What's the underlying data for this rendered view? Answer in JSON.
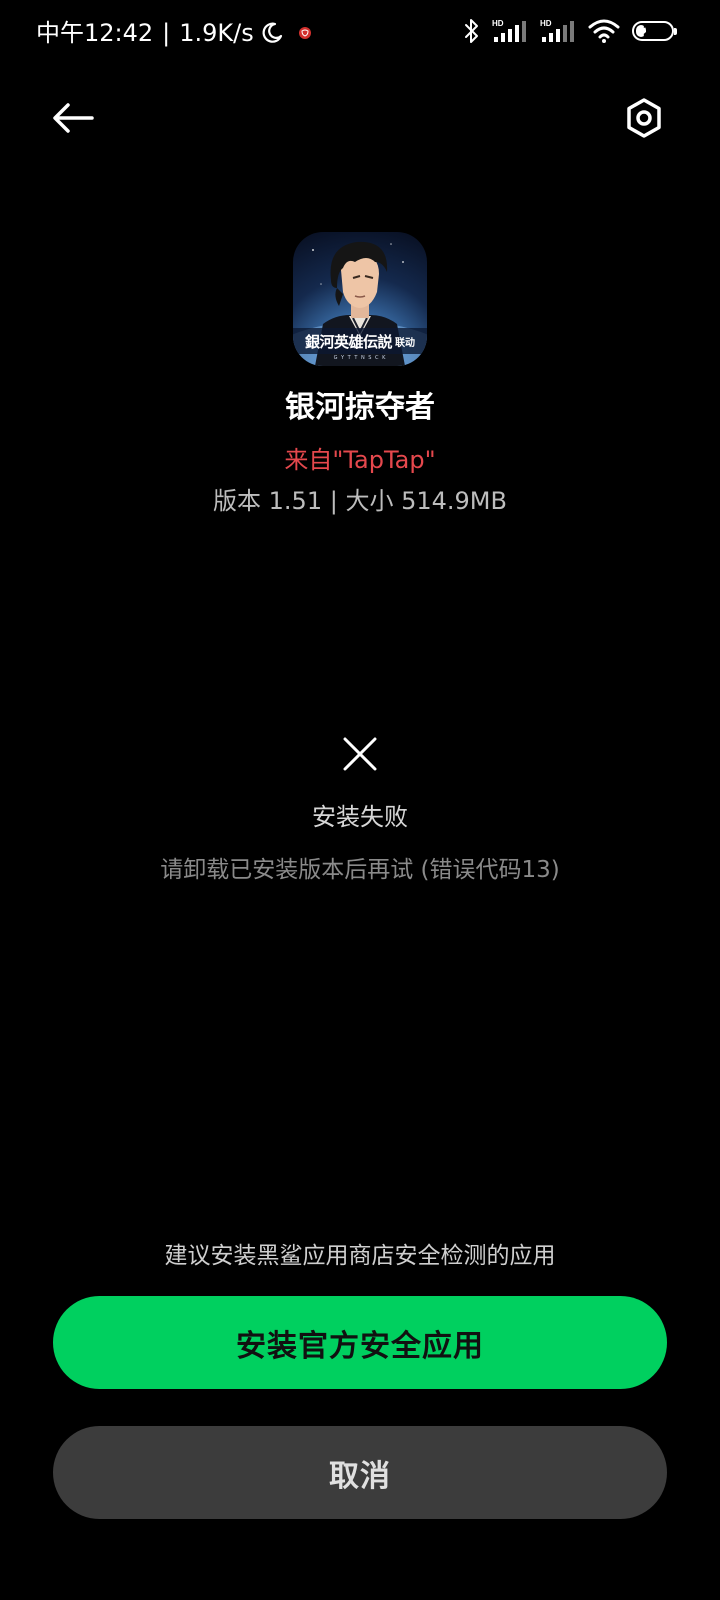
{
  "status_bar": {
    "time": "中午12:42",
    "separator": "|",
    "net_speed": "1.9K/s",
    "signal1_label": "HD",
    "signal2_label": "HD",
    "battery_level": "29",
    "battery_fraction": 0.29,
    "icons": [
      "moon-icon",
      "notification-icon",
      "bluetooth-icon",
      "cell-signal-icon",
      "cell-signal-icon",
      "wifi-icon",
      "battery-icon"
    ]
  },
  "nav": {
    "back_icon": "arrow-left-icon",
    "settings_icon": "hexagon-gear-icon"
  },
  "app": {
    "icon_banner_title": "銀河英雄伝説",
    "icon_banner_tag": "联动",
    "icon_banner_sub": "G Y T T N S  C K",
    "name": "银河掠夺者",
    "source": "来自\"TapTap\"",
    "meta": "版本 1.51 | 大小 514.9MB"
  },
  "install_result": {
    "icon": "close-icon",
    "title": "安装失败",
    "detail": "请卸载已安装版本后再试 (错误代码13)"
  },
  "footer": {
    "suggestion": "建议安装黑鲨应用商店安全检测的应用",
    "primary_label": "安装官方安全应用",
    "secondary_label": "取消"
  },
  "colors": {
    "background": "#000000",
    "source_red": "#e5484d",
    "primary_green": "#00d05f",
    "secondary_gray": "#3c3c3c"
  }
}
